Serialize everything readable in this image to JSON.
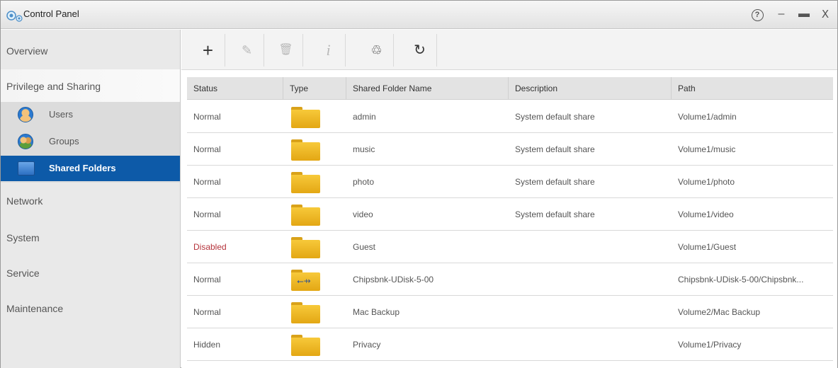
{
  "window": {
    "title": "Control Panel"
  },
  "titlebar": {
    "help": "?",
    "minimize": "–",
    "maximize": "▬",
    "close": "X"
  },
  "sidebar": {
    "items": [
      {
        "label": "Overview"
      },
      {
        "label": "Privilege and Sharing"
      },
      {
        "label": "Network"
      },
      {
        "label": "System"
      },
      {
        "label": "Service"
      },
      {
        "label": "Maintenance"
      }
    ],
    "sub_items": [
      {
        "label": "Users",
        "icon": "users-icon"
      },
      {
        "label": "Groups",
        "icon": "groups-icon"
      },
      {
        "label": "Shared Folders",
        "icon": "shared-folders-icon",
        "selected": true
      }
    ]
  },
  "toolbar": {
    "add": "+",
    "edit": "✎",
    "delete": "🗑",
    "info": "i",
    "recycle": "♲",
    "refresh": "↻"
  },
  "table": {
    "columns": [
      "Status",
      "Type",
      "Shared Folder Name",
      "Description",
      "Path"
    ],
    "rows": [
      {
        "status": "Normal",
        "type": "folder",
        "name": "admin",
        "description": "System default share",
        "path": "Volume1/admin"
      },
      {
        "status": "Normal",
        "type": "folder",
        "name": "music",
        "description": "System default share",
        "path": "Volume1/music"
      },
      {
        "status": "Normal",
        "type": "folder",
        "name": "photo",
        "description": "System default share",
        "path": "Volume1/photo"
      },
      {
        "status": "Normal",
        "type": "folder",
        "name": "video",
        "description": "System default share",
        "path": "Volume1/video"
      },
      {
        "status": "Disabled",
        "type": "folder",
        "name": "Guest",
        "description": "",
        "path": "Volume1/Guest"
      },
      {
        "status": "Normal",
        "type": "usb-folder",
        "name": "Chipsbnk-UDisk-5-00",
        "description": "",
        "path": "Chipsbnk-UDisk-5-00/Chipsbnk..."
      },
      {
        "status": "Normal",
        "type": "folder",
        "name": "Mac Backup",
        "description": "",
        "path": "Volume2/Mac Backup"
      },
      {
        "status": "Hidden",
        "type": "folder",
        "name": "Privacy",
        "description": "",
        "path": "Volume1/Privacy"
      }
    ]
  },
  "colors": {
    "selected_nav": "#0d5aa8",
    "disabled_status": "#b5333b",
    "folder": "#f2b720"
  }
}
